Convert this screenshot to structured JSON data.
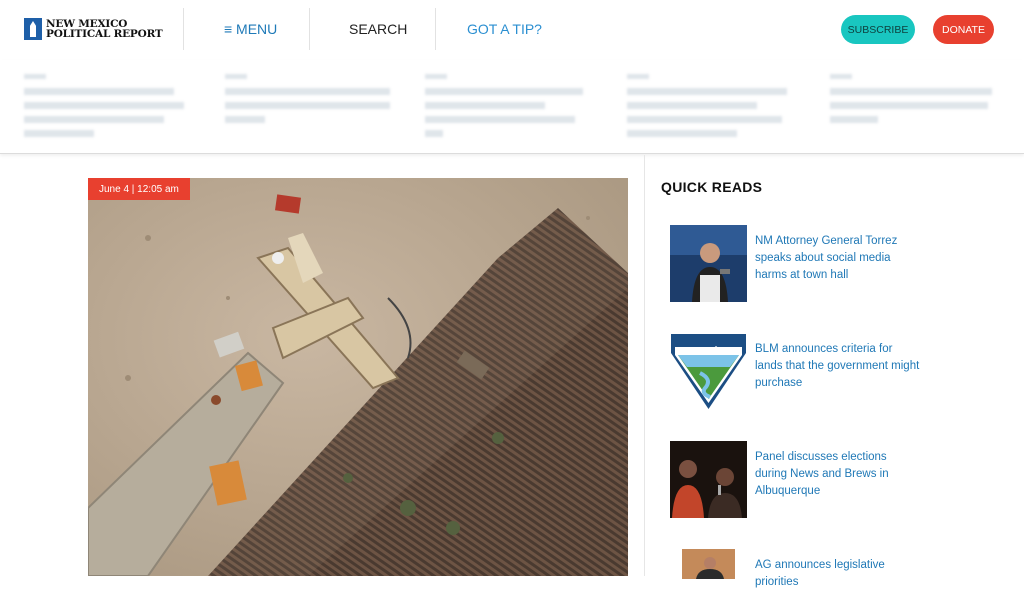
{
  "header": {
    "logo_line1": "NEW MEXICO",
    "logo_line2": "POLITICAL REPORT",
    "menu_label": "≡ MENU",
    "search_label": "SEARCH",
    "tip_label": "GOT A TIP?",
    "subscribe_label": "SUBSCRIBE",
    "donate_label": "DONATE",
    "colors": {
      "brand_blue": "#1e5fa8",
      "subscribe": "#19c6c0",
      "donate": "#e8402f"
    }
  },
  "ticker": [
    {
      "text": ""
    },
    {
      "text": ""
    },
    {
      "text": ""
    },
    {
      "text": ""
    },
    {
      "text": ""
    }
  ],
  "hero": {
    "date_badge": "June 4 | 12:05 am"
  },
  "quick_reads": {
    "title": "QUICK READS",
    "items": [
      {
        "headline": "NM Attorney General Torrez speaks about social media harms at town hall",
        "thumb_icon": "speaker-photo"
      },
      {
        "headline": "BLM announces criteria for lands that the government might purchase",
        "thumb_icon": "blm-shield-logo"
      },
      {
        "headline": "Panel discusses elections during News and Brews in Albuquerque",
        "thumb_icon": "panel-photo"
      },
      {
        "headline": "AG announces legislative priorities",
        "thumb_icon": "podium-photo"
      }
    ]
  }
}
